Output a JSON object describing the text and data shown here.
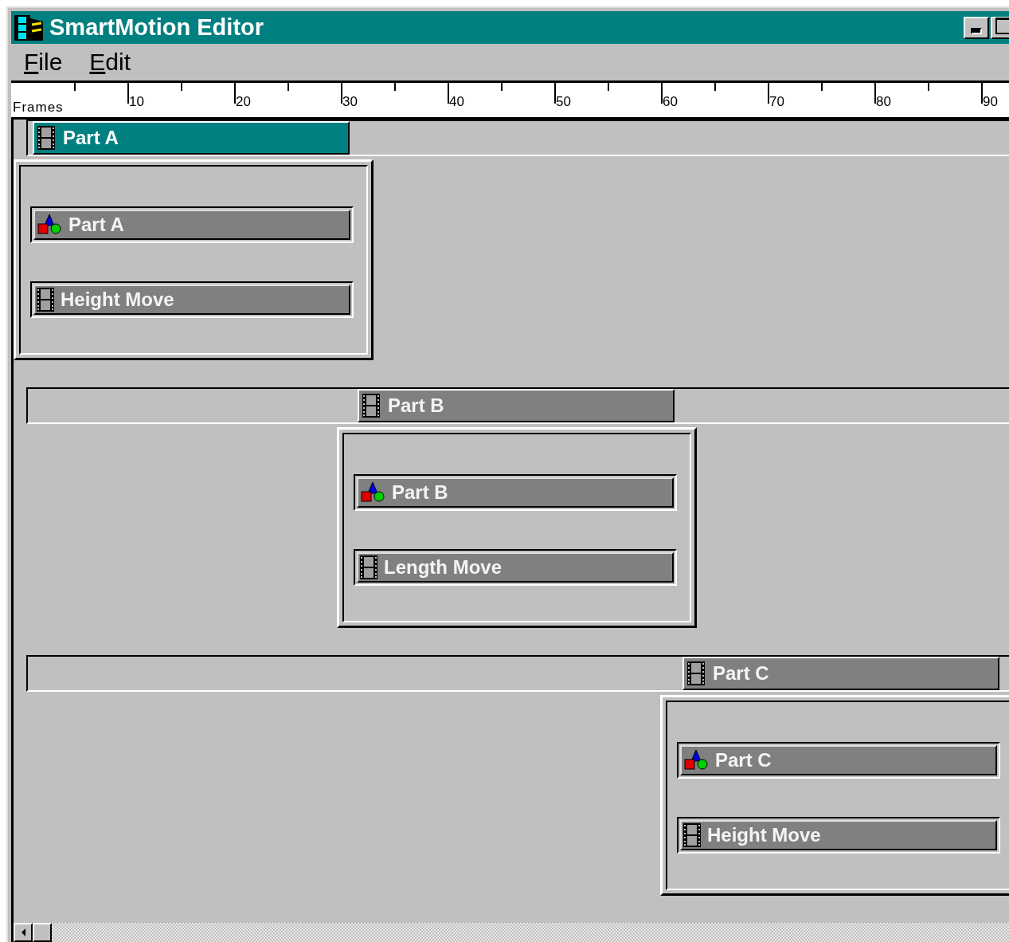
{
  "window": {
    "title": "SmartMotion Editor"
  },
  "menu": [
    {
      "label": "File"
    },
    {
      "label": "Edit"
    }
  ],
  "ruler": {
    "label": "Frames",
    "ticks": [
      "10",
      "20",
      "30",
      "40",
      "50",
      "60",
      "70",
      "80",
      "90"
    ]
  },
  "groups": [
    {
      "clip": {
        "label": "Part A",
        "selected": true
      },
      "items": [
        {
          "kind": "object",
          "label": "Part A"
        },
        {
          "kind": "motion",
          "label": "Height Move"
        }
      ]
    },
    {
      "clip": {
        "label": "Part B",
        "selected": false
      },
      "items": [
        {
          "kind": "object",
          "label": "Part B"
        },
        {
          "kind": "motion",
          "label": "Length Move"
        }
      ]
    },
    {
      "clip": {
        "label": "Part C",
        "selected": false
      },
      "items": [
        {
          "kind": "object",
          "label": "Part C"
        },
        {
          "kind": "motion",
          "label": "Height Move"
        }
      ]
    }
  ]
}
